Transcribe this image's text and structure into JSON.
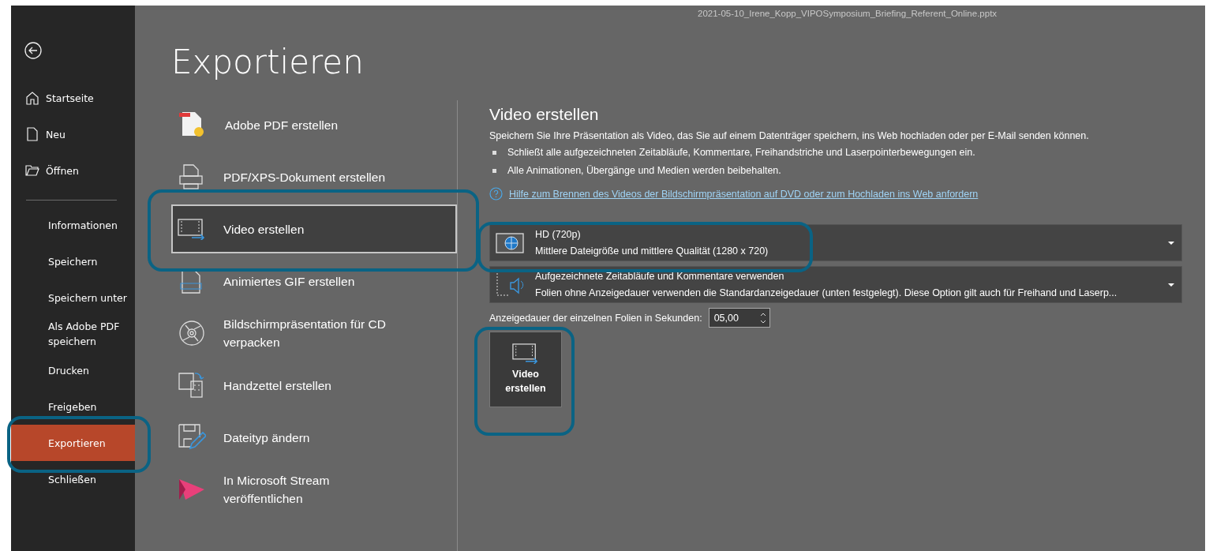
{
  "window": {
    "filename": "2021-05-10_Irene_Kopp_VIPOSymposium_Briefing_Referent_Online.pptx"
  },
  "sidebar": {
    "top_items": [
      {
        "label": "Startseite",
        "selected": false
      },
      {
        "label": "Neu",
        "selected": false
      },
      {
        "label": "Öffnen",
        "selected": false
      }
    ],
    "items": [
      {
        "label": "Informationen",
        "selected": false
      },
      {
        "label": "Speichern",
        "selected": false
      },
      {
        "label": "Speichern unter",
        "selected": false
      },
      {
        "label": "Als Adobe PDF speichern",
        "selected": false
      },
      {
        "label": "Drucken",
        "selected": false
      },
      {
        "label": "Freigeben",
        "selected": false
      },
      {
        "label": "Exportieren",
        "selected": true
      },
      {
        "label": "Schließen",
        "selected": false
      }
    ]
  },
  "page_title": "Exportieren",
  "export_options": [
    {
      "label": "Adobe PDF erstellen",
      "selected": false
    },
    {
      "label": "PDF/XPS-Dokument erstellen",
      "selected": false
    },
    {
      "label": "Video erstellen",
      "selected": true
    },
    {
      "label": "Animiertes GIF erstellen",
      "selected": false
    },
    {
      "label": "Bildschirmpräsentation für CD verpacken",
      "selected": false
    },
    {
      "label": "Handzettel erstellen",
      "selected": false
    },
    {
      "label": "Dateityp ändern",
      "selected": false
    },
    {
      "label": "In Microsoft Stream veröffentlichen",
      "selected": false
    }
  ],
  "panel": {
    "title": "Video erstellen",
    "description": "Speichern Sie Ihre Präsentation als Video, das Sie auf einem Datenträger speichern, ins Web hochladen oder per E-Mail senden können.",
    "bullets": [
      "Schließt alle aufgezeichneten Zeitabläufe, Kommentare, Freihandstriche und Laserpointerbewegungen ein.",
      "Alle Animationen, Übergänge und Medien werden beibehalten."
    ],
    "help_link": "Hilfe zum Brennen des Videos der Bildschirmpräsentation auf DVD oder zum Hochladen ins Web anfordern",
    "dropdowns": [
      {
        "title": "HD (720p)",
        "subtitle": "Mittlere Dateigröße und mittlere Qualität (1280 x 720)"
      },
      {
        "title": "Aufgezeichnete Zeitabläufe und Kommentare verwenden",
        "subtitle": "Folien ohne Anzeigedauer verwenden die Standardanzeigedauer (unten festgelegt). Diese Option gilt auch für Freihand und Laserp..."
      }
    ],
    "duration": {
      "label": "Anzeigedauer der einzelnen Folien in Sekunden:",
      "value": "05,00"
    },
    "create_button": "Video erstellen"
  }
}
